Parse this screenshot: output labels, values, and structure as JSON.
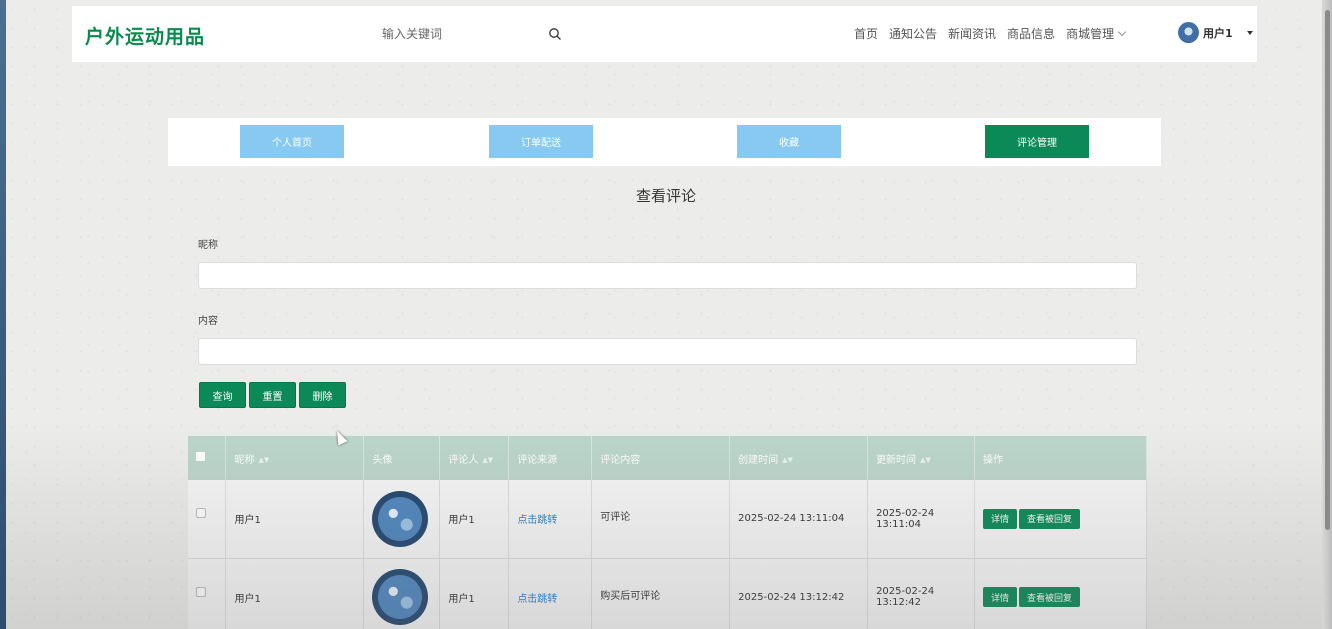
{
  "header": {
    "logo": "户外运动用品",
    "search_placeholder": "输入关键词",
    "nav": [
      "首页",
      "通知公告",
      "新闻资讯",
      "商品信息",
      "商城管理"
    ],
    "user_name": "用户1"
  },
  "tabs": [
    {
      "label": "个人首页",
      "active": false
    },
    {
      "label": "订单配送",
      "active": false
    },
    {
      "label": "收藏",
      "active": false
    },
    {
      "label": "评论管理",
      "active": true
    }
  ],
  "page_title": "查看评论",
  "form": {
    "nickname_label": "昵称",
    "nickname_value": "",
    "content_label": "内容",
    "content_value": ""
  },
  "buttons": {
    "query": "查询",
    "reset": "重置",
    "delete": "删除"
  },
  "table": {
    "headers": [
      "昵称",
      "头像",
      "评论人",
      "评论来源",
      "评论内容",
      "创建时间",
      "更新时间",
      "操作"
    ],
    "rows": [
      {
        "nickname": "用户1",
        "commenter": "用户1",
        "source": "点击跳转",
        "content": "可评论",
        "created": "2025-02-24 13:11:04",
        "updated": "2025-02-24 13:11:04",
        "action_detail": "详情",
        "action_reply": "查看被回复"
      },
      {
        "nickname": "用户1",
        "commenter": "用户1",
        "source": "点击跳转",
        "content": "购买后可评论",
        "created": "2025-02-24 13:12:42",
        "updated": "2025-02-24 13:12:42",
        "action_detail": "详情",
        "action_reply": "查看被回复"
      }
    ]
  },
  "colors": {
    "brand": "#0b8a57",
    "tab_inactive": "#87c9f0",
    "link": "#2a7fd0",
    "table_header": "#bcd6cb"
  }
}
